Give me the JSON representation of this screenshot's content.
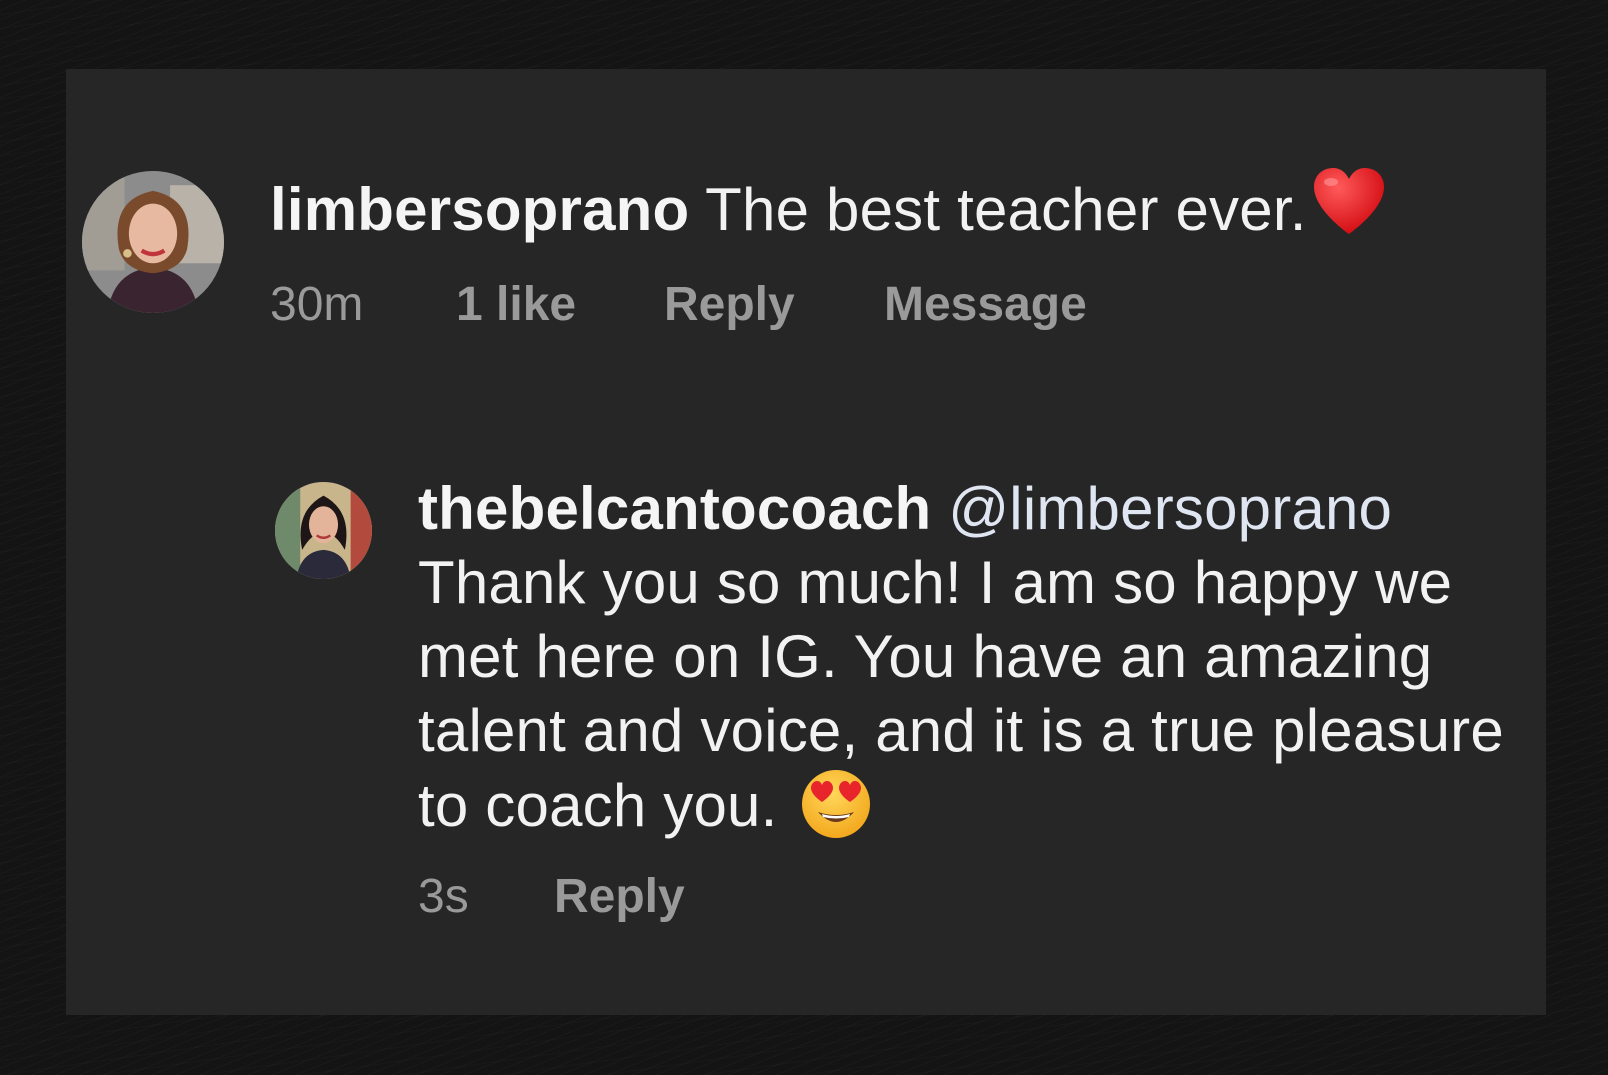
{
  "comments": [
    {
      "username": "limbersoprano",
      "text": "The best teacher ever.",
      "emoji": "red-heart",
      "time": "30m",
      "likes": "1 like",
      "reply_label": "Reply",
      "message_label": "Message"
    }
  ],
  "replies": [
    {
      "username": "thebelcantocoach",
      "mention": "@limbersoprano",
      "text": "Thank you so much! I am so happy we met here on IG. You have an amazing talent and voice, and it is a true pleasure to coach you.",
      "emoji": "smiling-face-with-heart-eyes",
      "time": "3s",
      "reply_label": "Reply"
    }
  ],
  "colors": {
    "background": "#141414",
    "card": "#262626",
    "text": "#f2f2f2",
    "meta": "#9a9a9a",
    "heart": "#e0161c"
  }
}
